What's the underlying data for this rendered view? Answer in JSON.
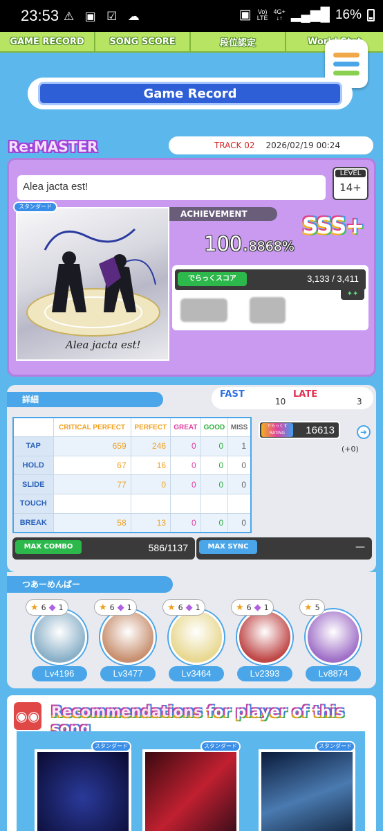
{
  "status_bar": {
    "time": "23:53",
    "battery": "16%",
    "net_top": "Vo)",
    "net_bottom": "LTE",
    "data_top": "4G+"
  },
  "nav": {
    "tabs": [
      "GAME RECORD",
      "SONG SCORE",
      "段位認定",
      "World Stat"
    ]
  },
  "page_title": "Game Record",
  "record": {
    "difficulty": "Re:MASTER",
    "track": "TRACK 02",
    "datetime": "2026/02/19 00:24",
    "song_title": "Alea jacta est!",
    "level_label": "LEVEL",
    "level": "14+",
    "chart_type": "スタンダード",
    "jacket_text": "Alea jacta est!",
    "achievement_label": "ACHIEVEMENT",
    "achievement_int": "100.",
    "achievement_dec": "8868%",
    "rank": "SSS+",
    "dx_label": "でらっくスコア",
    "dx_score": "3,133 / 3,411",
    "dx_stars": "✦✦"
  },
  "detail": {
    "label": "詳細",
    "fast_label": "FAST",
    "fast_value": "10",
    "late_label": "LATE",
    "late_value": "3",
    "columns": [
      "CRITICAL PERFECT",
      "PERFECT",
      "GREAT",
      "GOOD",
      "MISS"
    ],
    "rows": [
      {
        "name": "TAP",
        "values": [
          "659",
          "246",
          "0",
          "0",
          "1"
        ]
      },
      {
        "name": "HOLD",
        "values": [
          "67",
          "16",
          "0",
          "0",
          "0"
        ]
      },
      {
        "name": "SLIDE",
        "values": [
          "77",
          "0",
          "0",
          "0",
          "0"
        ]
      },
      {
        "name": "TOUCH",
        "values": [
          "",
          "",
          "",
          "",
          ""
        ]
      },
      {
        "name": "BREAK",
        "values": [
          "58",
          "13",
          "0",
          "0",
          "0"
        ]
      }
    ],
    "rating_label": "でらっくす RATING",
    "rating_value": "16613",
    "rating_delta": "(+0)",
    "max_combo_label": "MAX COMBO",
    "max_combo": "586/1137",
    "max_sync_label": "MAX SYNC",
    "max_sync": "—"
  },
  "members": {
    "label": "つあーめんばー",
    "list": [
      {
        "stars": "6",
        "crowns": "1",
        "level": "Lv4196",
        "color": "#8ab0c8"
      },
      {
        "stars": "6",
        "crowns": "1",
        "level": "Lv3477",
        "color": "#c89070"
      },
      {
        "stars": "6",
        "crowns": "1",
        "level": "Lv3464",
        "color": "#e8d890"
      },
      {
        "stars": "6",
        "crowns": "1",
        "level": "Lv2393",
        "color": "#c04848"
      },
      {
        "stars": "5",
        "crowns": "",
        "level": "Lv8874",
        "color": "#a070c8"
      }
    ]
  },
  "recommend": {
    "title_a": "Recommendations ",
    "title_b": "for player of ",
    "title_c": "this song",
    "chart_type": "スタンダード"
  }
}
